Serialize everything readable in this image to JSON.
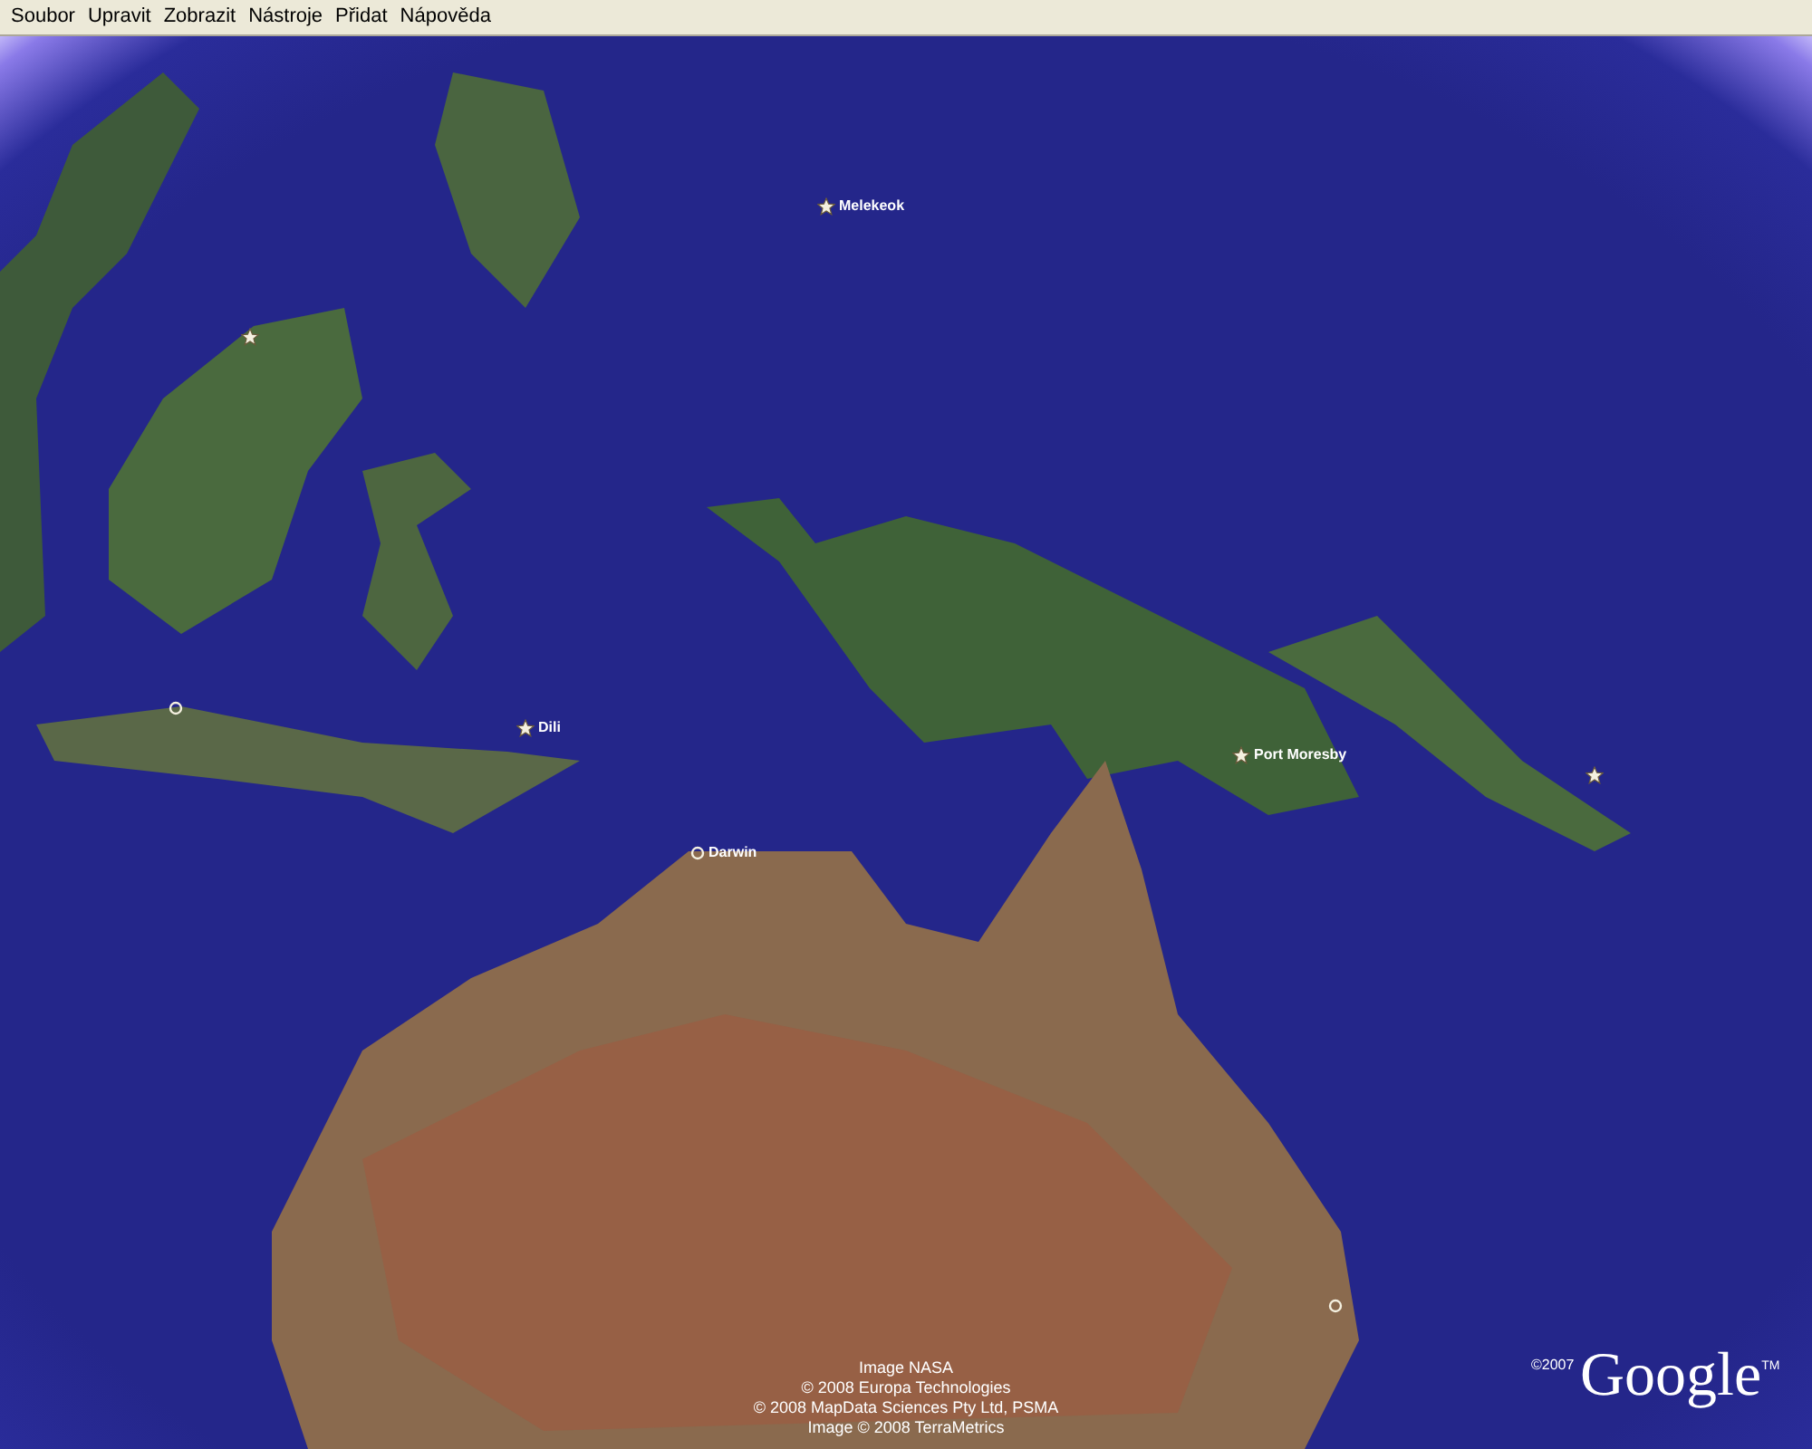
{
  "menu_bar": {
    "items": [
      "Soubor",
      "Upravit",
      "Zobrazit",
      "Nástroje",
      "Přidat",
      "Nápověda"
    ]
  },
  "map": {
    "places": [
      {
        "kind": "capital",
        "label": "Melekeok"
      },
      {
        "kind": "capital"
      },
      {
        "kind": "city"
      },
      {
        "kind": "capital",
        "label": "Dili"
      },
      {
        "kind": "city",
        "label": "Darwin"
      },
      {
        "kind": "capital",
        "label": "Port Moresby"
      },
      {
        "kind": "capital"
      },
      {
        "kind": "city"
      }
    ],
    "attribution": [
      "Image NASA",
      "© 2008 Europa Technologies",
      "© 2008 MapData Sciences Pty Ltd, PSMA",
      "Image © 2008 TerraMetrics"
    ],
    "copyright": "©2007",
    "logo": {
      "wordmark": "Google",
      "trademark": "TM"
    }
  }
}
